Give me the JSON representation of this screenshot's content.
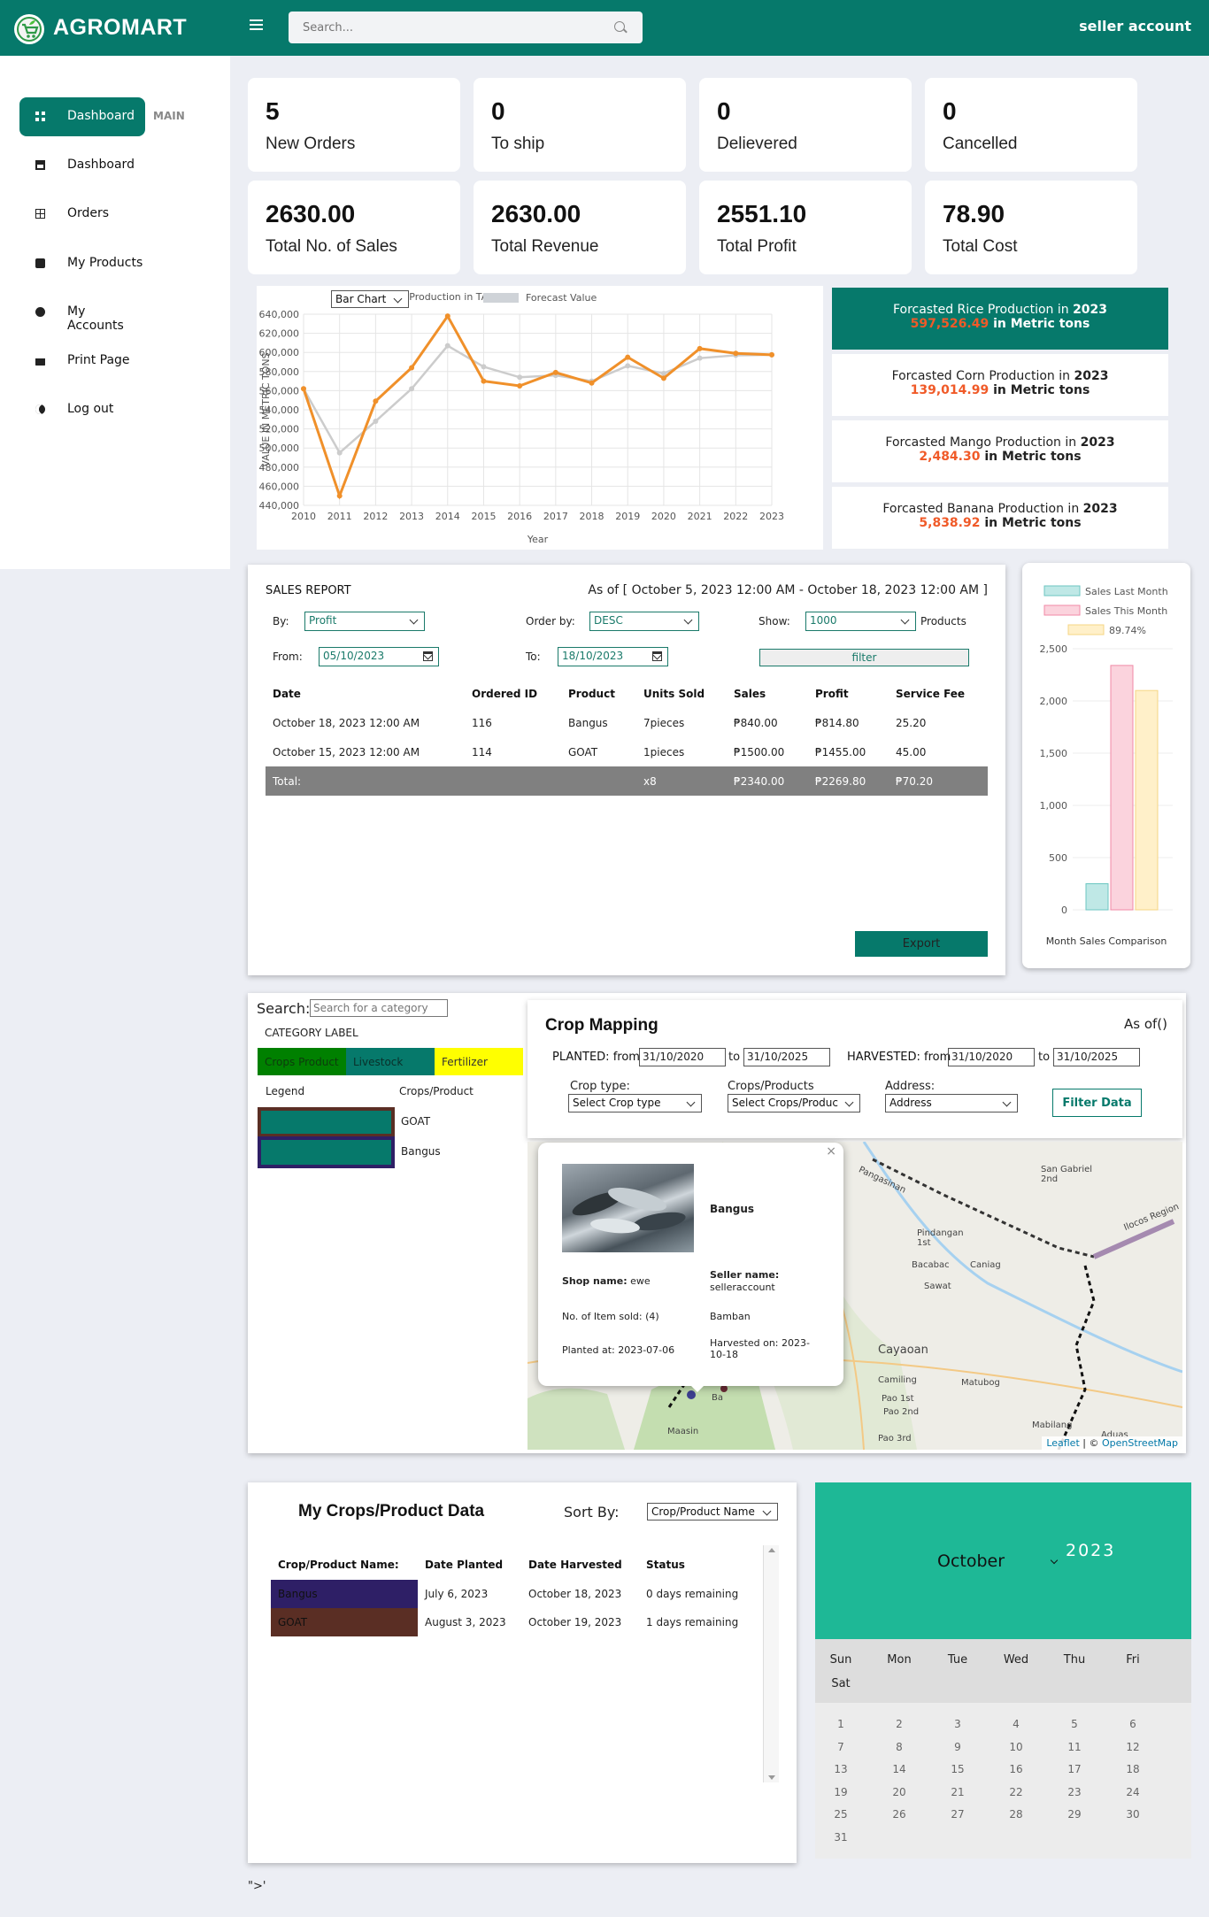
{
  "header": {
    "brand": "AGROMART",
    "search_placeholder": "Search...",
    "account": "seller account"
  },
  "sidebar": {
    "section_tag": "MAIN",
    "items": [
      {
        "label": "Dashboard",
        "icon": "dashboard-icon"
      },
      {
        "label": "Dashboard",
        "icon": "inbox-icon"
      },
      {
        "label": "Orders",
        "icon": "table-icon"
      },
      {
        "label": "My Products",
        "icon": "checkbox-icon"
      },
      {
        "label": "My Accounts",
        "icon": "user-icon"
      },
      {
        "label": "Print Page",
        "icon": "printer-icon"
      },
      {
        "label": "Log out",
        "icon": "logout-icon"
      }
    ]
  },
  "stats": [
    {
      "value": "5",
      "label": "New Orders"
    },
    {
      "value": "0",
      "label": "To ship"
    },
    {
      "value": "0",
      "label": "Delievered"
    },
    {
      "value": "0",
      "label": "Cancelled"
    },
    {
      "value": "2630.00",
      "label": "Total No. of Sales"
    },
    {
      "value": "2630.00",
      "label": "Total Revenue"
    },
    {
      "value": "2551.10",
      "label": "Total Profit"
    },
    {
      "value": "78.90",
      "label": "Total Cost"
    }
  ],
  "chart_select": "Bar Chart",
  "chart_data": [
    {
      "type": "line",
      "title": "",
      "xlabel": "Year",
      "ylabel": "VALUE IN METRIC TONS",
      "legend": [
        "nual Rice Production in TARLAC",
        "Forecast Value"
      ],
      "x": [
        2010,
        2011,
        2012,
        2013,
        2014,
        2015,
        2016,
        2017,
        2018,
        2019,
        2020,
        2021,
        2022,
        2023
      ],
      "yticks": [
        "640,000",
        "620,000",
        "600,000",
        "580,000",
        "560,000",
        "540,000",
        "520,000",
        "500,000",
        "480,000",
        "460,000",
        "440,000"
      ],
      "ylim": [
        440000,
        640000
      ],
      "series": [
        {
          "name": "nual Rice Production in TARLAC",
          "color": "#f0902a",
          "values": [
            562000,
            450000,
            549000,
            584000,
            638000,
            570000,
            565000,
            579000,
            568000,
            595000,
            573000,
            604000,
            599000,
            597500
          ]
        },
        {
          "name": "Forecast Value",
          "color": "#cccccc",
          "values": [
            562000,
            495000,
            528000,
            562000,
            607000,
            585000,
            574000,
            576000,
            570000,
            586000,
            578000,
            594000,
            597000,
            597500
          ]
        }
      ]
    },
    {
      "type": "bar",
      "title": "",
      "xlabel": "Month Sales Comparison",
      "ylim": [
        0,
        2500
      ],
      "yticks": [
        "2,500",
        "2,000",
        "1,500",
        "1,000",
        "500",
        "0"
      ],
      "series": [
        {
          "name": "Sales Last Month",
          "color": "#bfe8e6",
          "border": "#6cc6c2",
          "value": 250
        },
        {
          "name": "Sales This Month",
          "color": "#fbd3dd",
          "border": "#f08aa6",
          "value": 2340
        },
        {
          "name": "89.74%",
          "color": "#fff0c9",
          "border": "#f6d684",
          "value": 2100
        }
      ]
    }
  ],
  "forecasts": [
    {
      "pre": "Forcasted Rice Production in ",
      "year": "2023",
      "num": "597,526.49",
      "post": " in Metric tons"
    },
    {
      "pre": "Forcasted Corn Production in ",
      "year": "2023",
      "num": "139,014.99",
      "post": " in Metric tons"
    },
    {
      "pre": "Forcasted Mango Production in ",
      "year": "2023",
      "num": "2,484.30",
      "post": " in Metric tons"
    },
    {
      "pre": "Forcasted Banana Production in ",
      "year": "2023",
      "num": "5,838.92",
      "post": " in Metric tons"
    }
  ],
  "sales_report": {
    "title": "SALES REPORT",
    "asof": "As of [ October 5, 2023 12:00 AM - October 18, 2023 12:00 AM ]",
    "by_label": "By:",
    "by_value": "Profit",
    "order_label": "Order by:",
    "order_value": "DESC",
    "show_label": "Show:",
    "show_value": "1000",
    "products_label": "Products",
    "from_label": "From:",
    "from_value": "05/10/2023",
    "to_label": "To:",
    "to_value": "18/10/2023",
    "filter_label": "filter",
    "export_label": "Export",
    "columns": [
      "Date",
      "Ordered ID",
      "Product",
      "Units Sold",
      "Sales",
      "Profit",
      "Service Fee"
    ],
    "rows": [
      [
        "October 18, 2023 12:00 AM",
        "116",
        "Bangus",
        "7pieces",
        "₱840.00",
        "₱814.80",
        "25.20"
      ],
      [
        "October 15, 2023 12:00 AM",
        "114",
        "GOAT",
        "1pieces",
        "₱1500.00",
        "₱1455.00",
        "45.00"
      ]
    ],
    "total": [
      "Total:",
      "",
      "",
      "x8",
      "₱2340.00",
      "₱2269.80",
      "₱70.20"
    ]
  },
  "category": {
    "search_label": "Search:",
    "search_placeholder": "Search for a category",
    "label": "CATEGORY LABEL",
    "tabs": [
      {
        "label": "Crops Product",
        "color": "#008000"
      },
      {
        "label": "Livestock",
        "color": "#06796b"
      },
      {
        "label": "Fertilizer",
        "color": "#ffff00"
      }
    ],
    "legend_header": "Legend",
    "crops_header": "Crops/Product",
    "legend": [
      {
        "name": "GOAT",
        "border": "#5a2e24"
      },
      {
        "name": "Bangus",
        "border": "#2e1f66"
      }
    ]
  },
  "crop_mapping": {
    "title": "Crop Mapping",
    "asof": "As of()",
    "planted_label": "PLANTED:",
    "from1": "from",
    "planted_from": "31/10/2020",
    "to1": "to",
    "planted_to": "31/10/2025",
    "harvested_label": "HARVESTED:",
    "from2": "from",
    "harvested_from": "31/10/2020",
    "to2": "to",
    "harvested_to": "31/10/2025",
    "crop_type_label": "Crop type:",
    "crop_type_value": "Select Crop type",
    "crops_label": "Crops/Products",
    "crops_value": "Select Crops/Produc",
    "address_label": "Address:",
    "address_value": "Address",
    "filter_btn": "Filter Data"
  },
  "map": {
    "zoom_in": "+",
    "zoom_out": "−",
    "attribution_leaflet": "Leaflet",
    "attribution_sep": " | © ",
    "attribution_osm": "OpenStreetMap",
    "places": [
      "San Gabriel\n2nd",
      "Pangasinan",
      "Ilocos Region",
      "Pindangan\n1st",
      "Bacabac",
      "Caniag",
      "Sawat",
      "Cayaoan",
      "Camiling",
      "Matubog",
      "Pao 1st",
      "Pao 2nd",
      "Pao 3rd",
      "Mabilang",
      "Aduas",
      "Maasin",
      "Ba"
    ],
    "popup": {
      "close": "×",
      "product": "Bangus",
      "shop_label": "Shop name:",
      "shop": "ewe",
      "seller_label": "Seller name:",
      "seller": "selleraccount",
      "sold": "No. of Item sold: (4)",
      "location": "Bamban",
      "planted": "Planted at: 2023-07-06",
      "harvested": "Harvested on: 2023-10-18"
    }
  },
  "crops_data": {
    "title": "My Crops/Product Data",
    "sort_label": "Sort By:",
    "sort_value": "Crop/Product Name",
    "columns": [
      "Crop/Product Name:",
      "Date Planted",
      "Date Harvested",
      "Status"
    ],
    "rows": [
      {
        "name": "Bangus",
        "color": "#2e1f66",
        "planted": "July 6, 2023",
        "harvested": "October 18, 2023",
        "status": "0 days remaining"
      },
      {
        "name": "GOAT",
        "color": "#5a2e24",
        "planted": "August 3, 2023",
        "harvested": "October 19, 2023",
        "status": "1 days remaining"
      }
    ]
  },
  "calendar": {
    "month": "October",
    "year": "2023",
    "days": [
      "Sun",
      "Mon",
      "Tue",
      "Wed",
      "Thu",
      "Fri",
      "Sat"
    ],
    "dates": [
      "1",
      "2",
      "3",
      "4",
      "5",
      "6",
      "7",
      "8",
      "9",
      "10",
      "11",
      "12",
      "13",
      "14",
      "15",
      "16",
      "17",
      "18",
      "19",
      "20",
      "21",
      "22",
      "23",
      "24",
      "25",
      "26",
      "27",
      "28",
      "29",
      "30",
      "31"
    ]
  },
  "footer": "\">'"
}
